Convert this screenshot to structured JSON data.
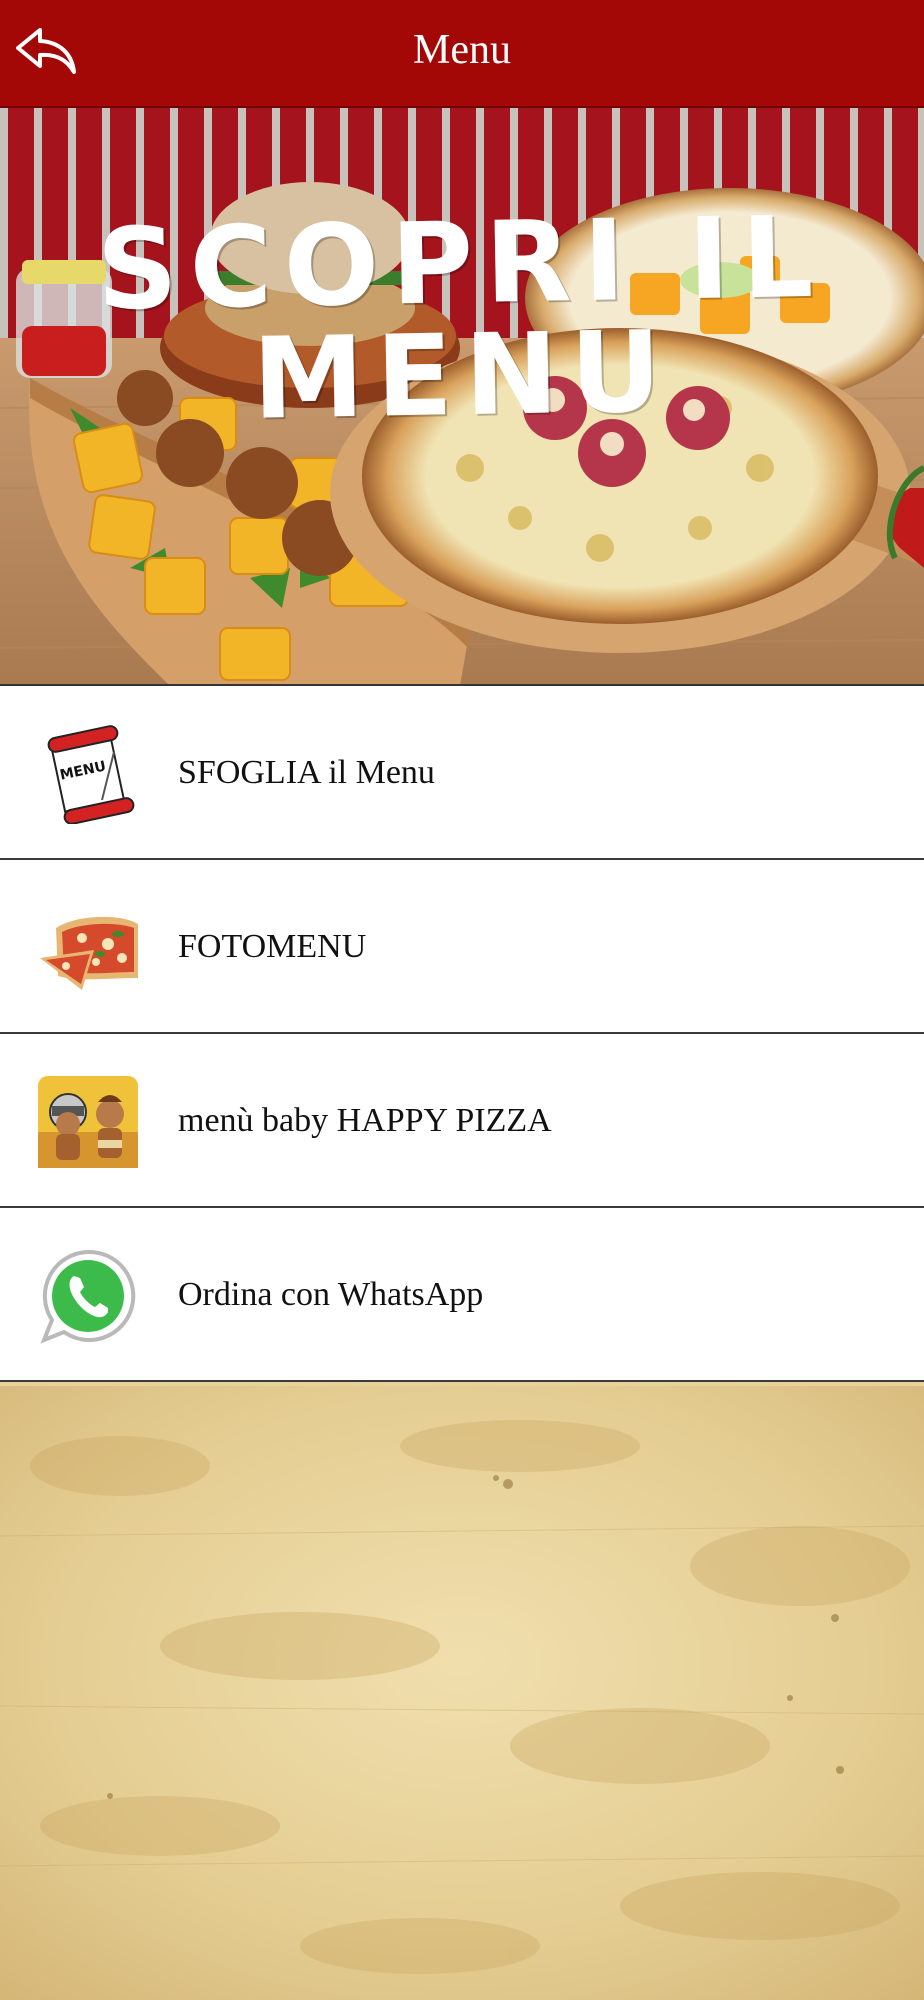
{
  "header": {
    "title": "Menu",
    "back_icon": "back-arrow-icon",
    "background_color": "#a30806"
  },
  "banner": {
    "title": "SCOPRI IL MENU",
    "image": "pizza-burger-fried-food-photo"
  },
  "menu_items": [
    {
      "label": "SFOGLIA il Menu",
      "icon": "menu-scroll-icon"
    },
    {
      "label": "FOTOMENU",
      "icon": "pizza-slice-icon"
    },
    {
      "label": "menù baby HAPPY PIZZA",
      "icon": "gladiator-kids-icon"
    },
    {
      "label": "Ordina con WhatsApp",
      "icon": "whatsapp-icon"
    }
  ],
  "background": {
    "texture": "parchment",
    "color": "#e6d29a"
  }
}
